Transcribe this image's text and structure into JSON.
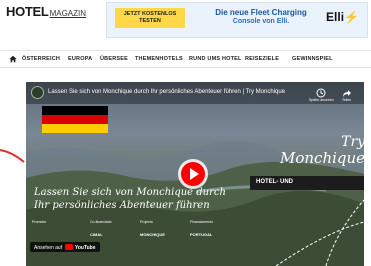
{
  "header": {
    "logo_main": "HOTEL",
    "logo_sub": "MAGAZIN"
  },
  "ad": {
    "cta_line1": "JETZT KOSTENLOS",
    "cta_line2": "TESTEN",
    "headline_line1": "Die neue Fleet Charging",
    "headline_line2": "Console von Elli.",
    "brand": "Elli"
  },
  "nav": {
    "items": [
      "ÖSTERREICH",
      "EUROPA",
      "ÜBERSEE",
      "THEMENHOTELS",
      "RUND UMS HOTEL",
      "REISEZIELE",
      "GEWINNSPIEL"
    ]
  },
  "video": {
    "title": "Lassen Sie sich von Monchique durch Ihr persönliches Abenteuer führen | Try Monchique",
    "watch_later": "Später ansehen",
    "share": "Teilen",
    "brand_line1": "Try",
    "brand_line2": "Monchique",
    "caption_line1": "Lassen Sie sich von Monchique durch",
    "caption_line2": "Ihr persönliches Abenteuer führen",
    "partner_labels": [
      "Promotor",
      "Co-financiado",
      "Projecto",
      "Financiamento"
    ],
    "partner_marks": [
      "ASSOCIAÇÃO",
      "CIMAL",
      "MONCHIQUE",
      "PORTUGAL"
    ],
    "youtube_prefix": "Ansehen auf",
    "youtube_word": "YouTube",
    "colors": {
      "play": "#ff0000",
      "flag_black": "#000000",
      "flag_red": "#dd0000",
      "flag_gold": "#ffce00"
    }
  },
  "side_card": {
    "text": "HOTEL- UND"
  }
}
